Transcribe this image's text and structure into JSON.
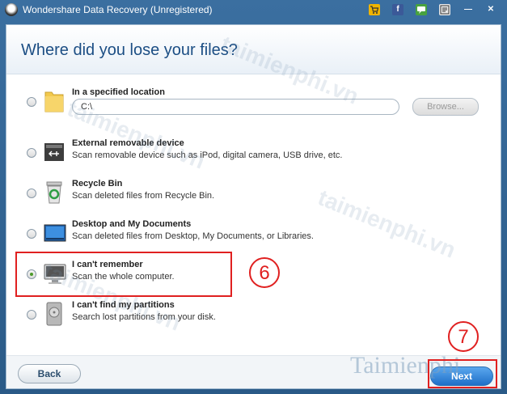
{
  "window": {
    "title": "Wondershare Data Recovery (Unregistered)",
    "controls": {
      "minimize": "—",
      "close": "✕",
      "facebook": "f"
    }
  },
  "header": {
    "title": "Where did you lose your files?"
  },
  "options": [
    {
      "title": "In a specified location",
      "path_value": "C:\\",
      "browse_label": "Browse...",
      "icon": "folder-icon",
      "checked": false
    },
    {
      "title": "External removable device",
      "desc": "Scan removable device such as iPod, digital camera, USB drive, etc.",
      "icon": "usb-icon",
      "checked": false
    },
    {
      "title": "Recycle Bin",
      "desc": "Scan deleted files from Recycle Bin.",
      "icon": "recycle-bin-icon",
      "checked": false
    },
    {
      "title": "Desktop and My Documents",
      "desc": "Scan deleted files from Desktop, My Documents, or Libraries.",
      "icon": "desktop-icon",
      "checked": false
    },
    {
      "title": "I can't remember",
      "desc": "Scan the whole computer.",
      "icon": "computer-icon",
      "checked": true
    },
    {
      "title": "I can't find my partitions",
      "desc": "Search lost partitions from your disk.",
      "icon": "hard-drive-icon",
      "checked": false
    }
  ],
  "footer": {
    "back_label": "Back",
    "next_label": "Next"
  },
  "annotations": {
    "step6": "6",
    "step7": "7"
  },
  "watermark": {
    "text": "taimienphi.vn",
    "logo": "Taimienphi"
  },
  "colors": {
    "title_blue": "#1c4e84",
    "next_blue": "#1f6fc8",
    "annotation_red": "#e02020"
  }
}
